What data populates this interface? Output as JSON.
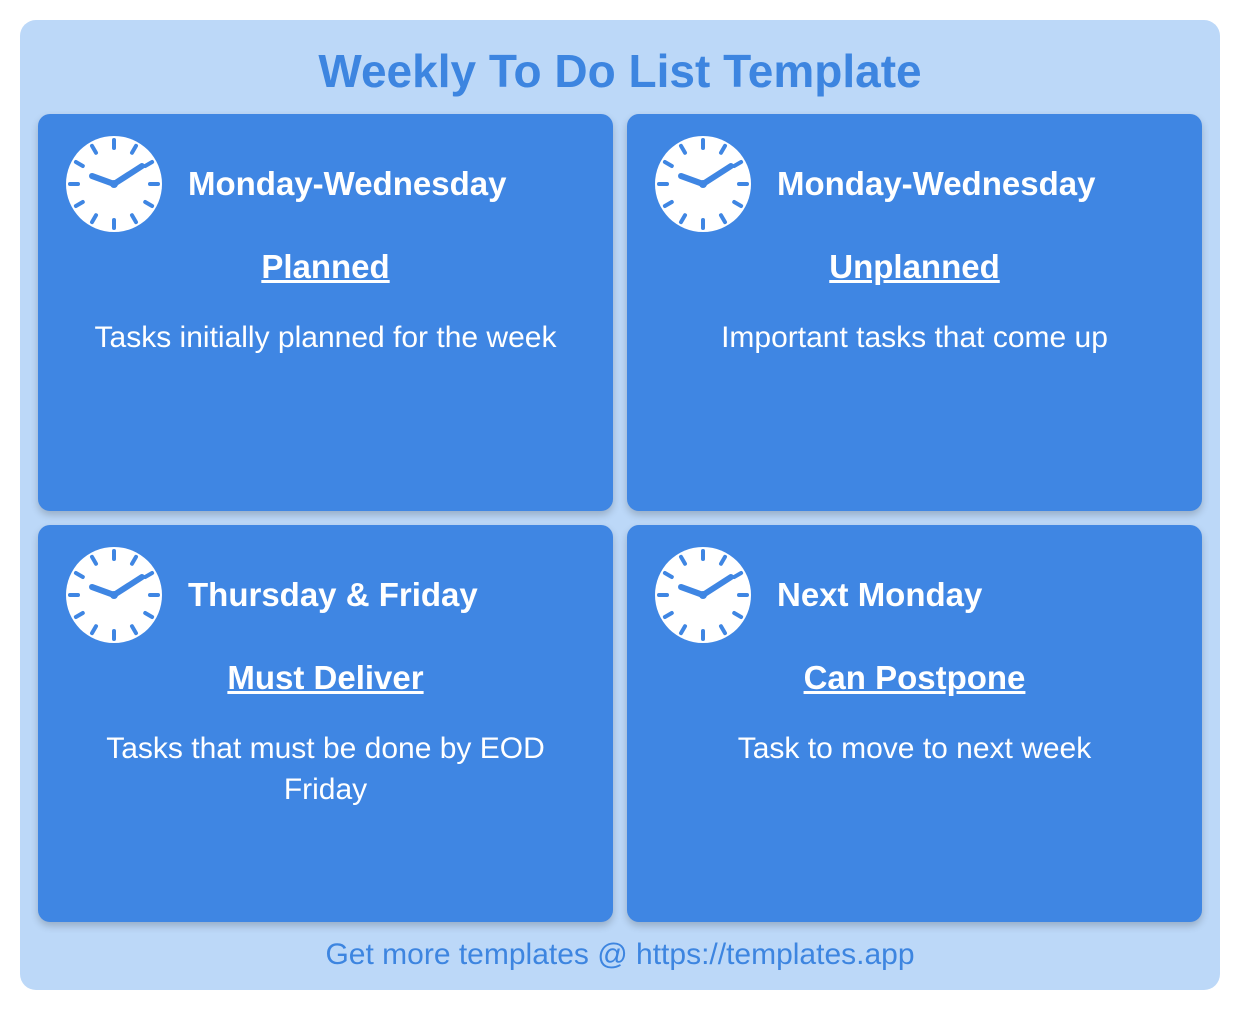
{
  "title": "Weekly To Do List Template",
  "cards": [
    {
      "day": "Monday-Wednesday",
      "category": "Planned",
      "desc": "Tasks initially planned for the week"
    },
    {
      "day": "Monday-Wednesday",
      "category": "Unplanned",
      "desc": "Important tasks that come up"
    },
    {
      "day": "Thursday & Friday",
      "category": "Must Deliver",
      "desc": "Tasks that must be done by EOD Friday"
    },
    {
      "day": "Next Monday",
      "category": "Can Postpone",
      "desc": "Task to move to next week"
    }
  ],
  "footer": "Get more templates @ https://templates.app"
}
